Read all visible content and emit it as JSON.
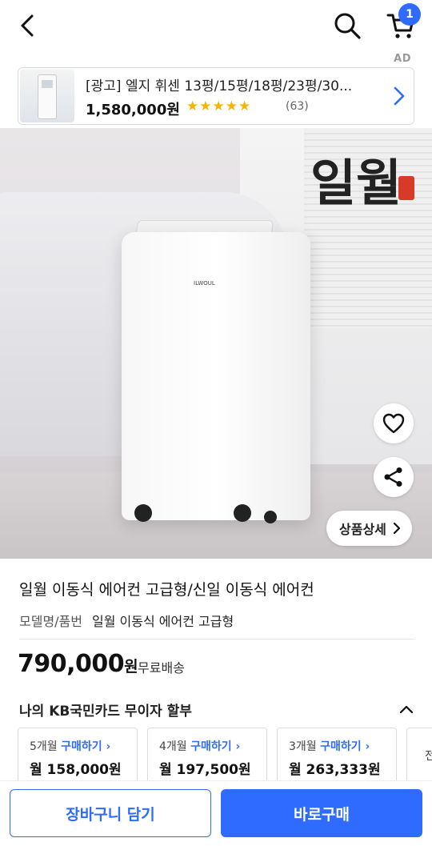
{
  "header": {
    "cart_count": "1",
    "ad_label": "AD"
  },
  "ad": {
    "title": "[광고] 엘지 휘센 13평/15평/18평/23평/30...",
    "price": "1,580,000원",
    "stars": "★★★★★",
    "rating_count": "(63)"
  },
  "hero": {
    "brand_text": "일월",
    "detail_button": "상품상세"
  },
  "product": {
    "title": "일월 이동식 에어컨 고급형/신일 이동식 에어컨",
    "model_label": "모델명/품번",
    "model_value": "일월 이동식 에어컨 고급형",
    "price_number": "790,000",
    "price_unit": "원",
    "shipping": "무료배송"
  },
  "installments": {
    "title": "나의 KB국민카드 무이자 할부",
    "plans": [
      {
        "months": "5개월",
        "buy": "구매하기 ›",
        "monthly": "월 158,000원"
      },
      {
        "months": "4개월",
        "buy": "구매하기 ›",
        "monthly": "월 197,500원"
      },
      {
        "months": "3개월",
        "buy": "구매하기 ›",
        "monthly": "월 263,333원"
      },
      {
        "months": "전",
        "buy": "",
        "monthly": ""
      }
    ]
  },
  "bottom": {
    "add_to_cart": "장바구니 담기",
    "buy_now": "바로구매"
  },
  "colors": {
    "accent": "#2f6bff",
    "star": "#f5b400"
  }
}
